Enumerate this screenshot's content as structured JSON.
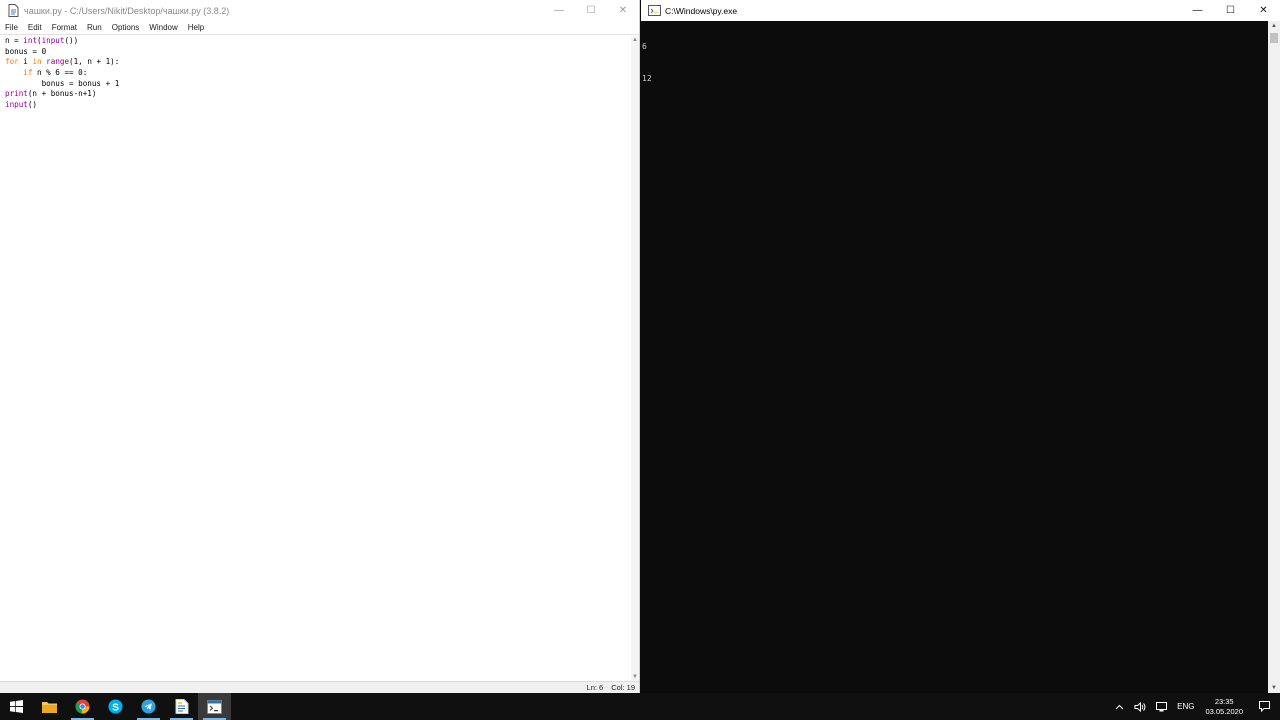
{
  "idle": {
    "title": "чашки.py - C:/Users/Nikit/Desktop/чашки.py (3.8.2)",
    "menu": [
      "File",
      "Edit",
      "Format",
      "Run",
      "Options",
      "Window",
      "Help"
    ],
    "code": [
      [
        {
          "t": "n = ",
          "c": ""
        },
        {
          "t": "int",
          "c": "bi"
        },
        {
          "t": "(",
          "c": ""
        },
        {
          "t": "input",
          "c": "bi"
        },
        {
          "t": "())",
          "c": ""
        }
      ],
      [
        {
          "t": "bonus = 0",
          "c": ""
        }
      ],
      [
        {
          "t": "for",
          "c": "kw"
        },
        {
          "t": " i ",
          "c": ""
        },
        {
          "t": "in",
          "c": "kw"
        },
        {
          "t": " ",
          "c": ""
        },
        {
          "t": "range",
          "c": "bi"
        },
        {
          "t": "(1, n + 1):",
          "c": ""
        }
      ],
      [
        {
          "t": "    ",
          "c": ""
        },
        {
          "t": "if",
          "c": "kw"
        },
        {
          "t": " n % 6 == 0:",
          "c": ""
        }
      ],
      [
        {
          "t": "        bonus = bonus + 1",
          "c": ""
        }
      ],
      [
        {
          "t": "print",
          "c": "bi"
        },
        {
          "t": "(n + bonus-n+1)",
          "c": ""
        }
      ],
      [
        {
          "t": "input",
          "c": "bi"
        },
        {
          "t": "()",
          "c": ""
        }
      ]
    ],
    "status": {
      "ln": "Ln: 6",
      "col": "Col: 19"
    }
  },
  "console": {
    "title": "C:\\Windows\\py.exe",
    "output": [
      "6",
      "12"
    ]
  },
  "window_controls": {
    "minimize": "—",
    "maximize": "☐",
    "close": "✕"
  },
  "taskbar": {
    "apps": [
      {
        "name": "start-button",
        "icon": "windows-logo"
      },
      {
        "name": "file-explorer",
        "icon": "folder-icon"
      },
      {
        "name": "chrome",
        "icon": "chrome-icon"
      },
      {
        "name": "skype",
        "icon": "skype-icon"
      },
      {
        "name": "telegram",
        "icon": "telegram-icon"
      },
      {
        "name": "idle-editor",
        "icon": "idle-icon"
      },
      {
        "name": "python-console",
        "icon": "python-console-icon"
      }
    ],
    "lang": "ENG",
    "time": "23:35",
    "date": "03.05.2020"
  }
}
